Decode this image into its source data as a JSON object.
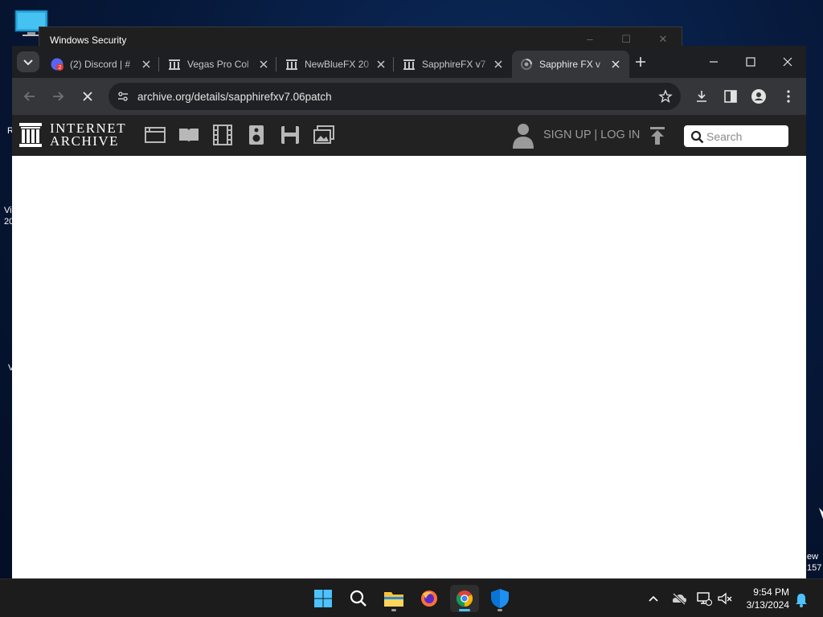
{
  "desktop": {
    "fragment_r": "R",
    "fragment_vi": "Vi",
    "fragment_20": "20",
    "fragment_v": "V",
    "fragment_ew": "ew",
    "fragment_157": "157"
  },
  "background_window": {
    "title": "Windows Security"
  },
  "browser": {
    "tabs": [
      {
        "label": "(2) Discord | #",
        "icon": "discord-icon",
        "badge": "2"
      },
      {
        "label": "Vegas Pro Col",
        "icon": "archive-icon"
      },
      {
        "label": "NewBlueFX 20",
        "icon": "archive-icon"
      },
      {
        "label": "SapphireFX v7",
        "icon": "archive-icon"
      },
      {
        "label": "Sapphire FX v",
        "icon": "loading-icon",
        "active": true
      }
    ],
    "address": "archive.org/details/sapphirefxv7.06patch"
  },
  "archive_header": {
    "logo_line1": "INTERNET",
    "logo_line2": "ARCHIVE",
    "media_icons": [
      "web-icon",
      "texts-icon",
      "video-icon",
      "audio-icon",
      "software-icon",
      "images-icon"
    ],
    "signup_text": "SIGN UP | LOG IN",
    "search_placeholder": "Search"
  },
  "taskbar": {
    "apps": [
      "start-icon",
      "search-icon",
      "file-explorer-icon",
      "firefox-icon",
      "chrome-icon",
      "windows-security-icon"
    ],
    "time": "9:54 PM",
    "date": "3/13/2024"
  },
  "colors": {
    "ia_header_bg": "#222222",
    "chrome_toolbar": "#35363a",
    "chrome_frame": "#1e1f22",
    "accent": "#4cc2ff"
  }
}
